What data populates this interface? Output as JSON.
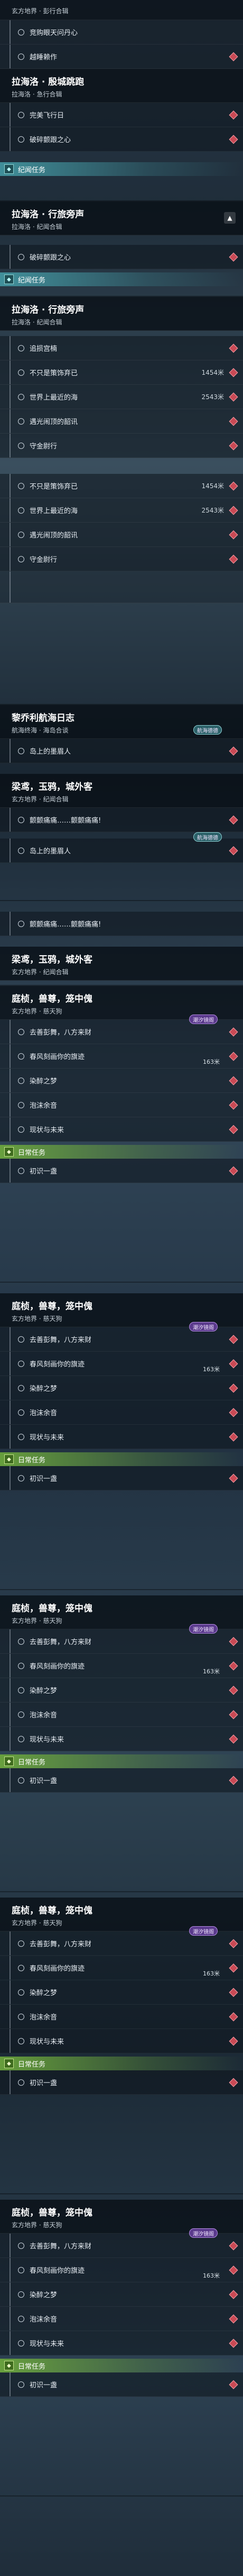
{
  "title_xuanfang": "玄方地界 · 彭行合辑",
  "panel1": {
    "row1": "竞购眼天问丹心",
    "row2": "越睡赖作",
    "head": {
      "t": "拉海洛 · 殷城跳跑",
      "s": "拉海洛 · 急行合辑"
    },
    "row3": "完美飞行日",
    "row4": "破碎颤跟之心",
    "sec": "纪闻任务"
  },
  "panel2": {
    "head": {
      "t": "拉海洛 · 行旅旁声",
      "s": "拉海洛 · 纪闻合辑"
    },
    "row1": "破碎颤跟之心",
    "sec": "纪闻任务",
    "head2": {
      "t": "拉海洛 · 行旅旁声",
      "s": "拉海洛 · 纪闻合辑"
    }
  },
  "panel3": {
    "rows": [
      {
        "label": "追损宫楠",
        "dist": ""
      },
      {
        "label": "不只是策饰弃已",
        "dist": "1454米"
      },
      {
        "label": "世界上最近的海",
        "dist": "2543米"
      },
      {
        "label": "遇光闹顶的韶讯",
        "dist": ""
      },
      {
        "label": "守金尉行",
        "dist": ""
      },
      {
        "label": "不只是策饰弃已",
        "dist": "1454米"
      },
      {
        "label": "世界上最近的海",
        "dist": "2543米"
      },
      {
        "label": "遇光闹顶的韶讯",
        "dist": ""
      },
      {
        "label": "守金尉行",
        "dist": ""
      }
    ]
  },
  "panel4": {
    "head": {
      "t": "黎乔利航海日志",
      "s": "航海终海 · 海岛合谈"
    },
    "tag": "航海德德",
    "row1": "岛上的墨眉人",
    "head2": {
      "t": "梁鸢，玉鸦，城外客",
      "s": "玄方地界 · 纪闻合辑"
    },
    "row2": "颤颤痛痛……颤颤痛痛!",
    "tag2": "航海德德",
    "row3": "岛上的墨眉人"
  },
  "panel5": {
    "head": {
      "t": "梁鸢，玉鸦，城外客",
      "s": "玄方地界 · 纪闻合辑"
    },
    "row1": "颤颤痛痛……颤颤痛痛!"
  },
  "repeat": {
    "head": {
      "t": "庭桢，兽尊，笼中傀",
      "s": "玄方地界 · 慈天狗"
    },
    "rows": [
      {
        "label": "去善彭舞，八方来财",
        "dist": ""
      },
      {
        "label": "春风刻画你的旗迹",
        "dist": "163米"
      },
      {
        "label": "染醉之梦",
        "dist": ""
      },
      {
        "label": "泡沫余音",
        "dist": ""
      },
      {
        "label": "现状与未来",
        "dist": ""
      }
    ],
    "tag": "潮汐镜阁",
    "sec": "日常任务",
    "daily": "初识一盏"
  }
}
